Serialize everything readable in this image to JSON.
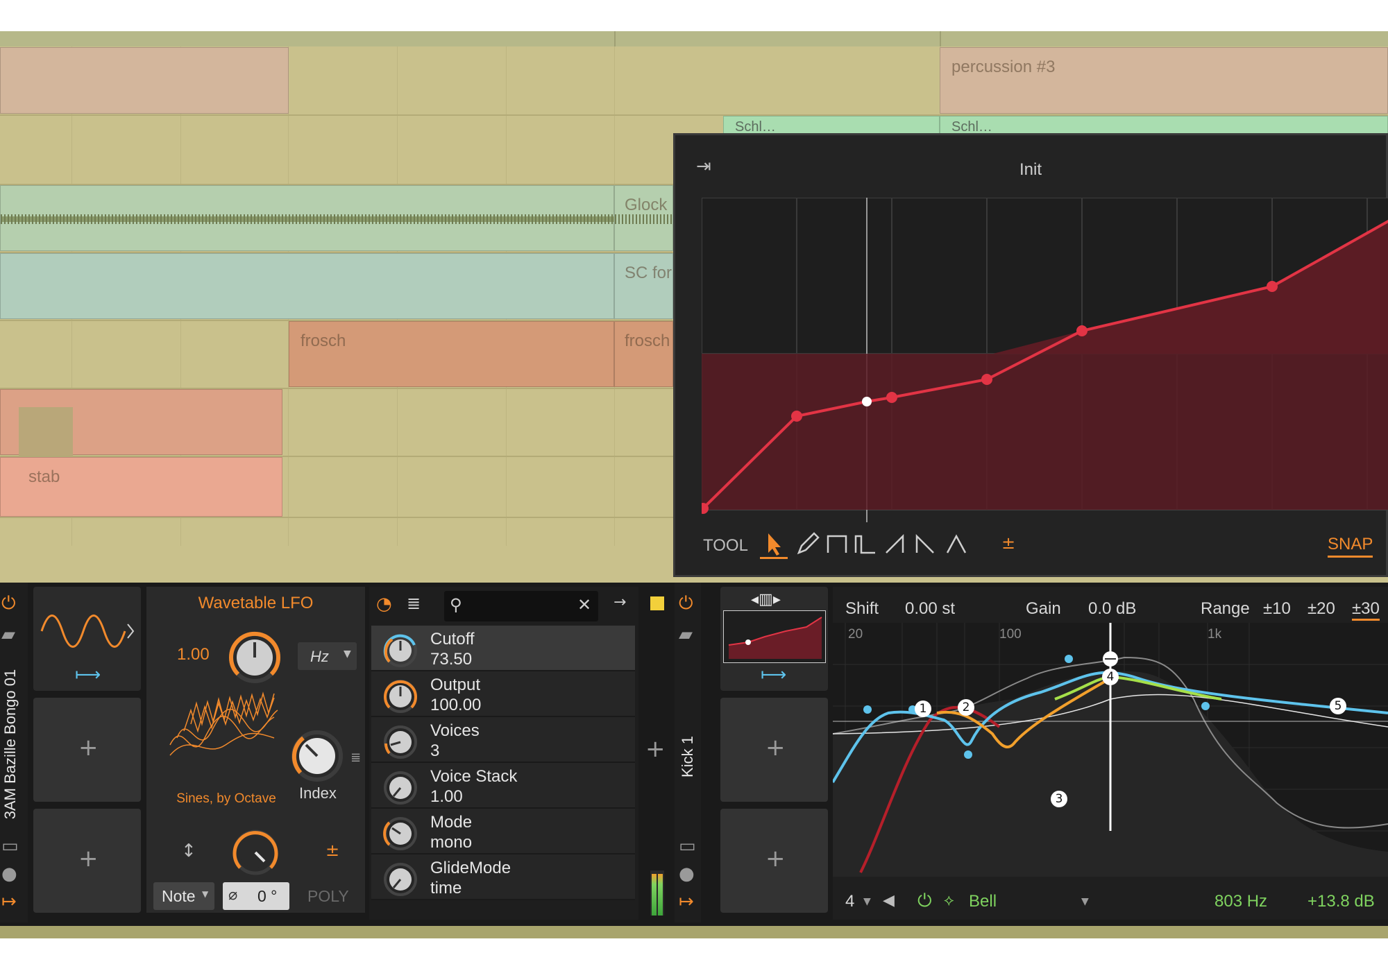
{
  "arranger": {
    "clips": {
      "percussion": "percussion #3",
      "sc_a": "Schl…",
      "sc_b": "Schl…",
      "glock": "Glock",
      "scfor": "SC for",
      "frosch1": "frosch",
      "frosch2": "frosch",
      "stab": "stab"
    }
  },
  "popup": {
    "title": "Init",
    "tool_label": "TOOL",
    "plus_minus": "±",
    "snap_label": "SNAP",
    "tools": [
      "pointer-icon",
      "pencil-icon",
      "square-wave-icon",
      "pulse-wave-icon",
      "saw-up-icon",
      "saw-down-icon",
      "triangle-icon"
    ]
  },
  "lfo": {
    "title": "Wavetable LFO",
    "rate_value": "1.00",
    "unit": "Hz",
    "wavetable_name": "Sines, by Octave",
    "index_label": "Index",
    "pm": "±",
    "mode": "Note",
    "phase_symbol": "⌀",
    "phase_value": "0 °",
    "poly": "POLY"
  },
  "params": [
    {
      "name": "Cutoff",
      "value": "73.50"
    },
    {
      "name": "Output",
      "value": "100.00"
    },
    {
      "name": "Voices",
      "value": "3"
    },
    {
      "name": "Voice Stack",
      "value": "1.00"
    },
    {
      "name": "Mode",
      "value": "mono"
    },
    {
      "name": "GlideMode",
      "value": "time"
    }
  ],
  "tracks": {
    "left": "3AM Bazille Bongo 01",
    "right": "Kick 1"
  },
  "eq": {
    "shift_label": "Shift",
    "shift_value": "0.00 st",
    "gain_label": "Gain",
    "gain_value": "0.0 dB",
    "range_label": "Range",
    "range_options": [
      "±10",
      "±20",
      "±30"
    ],
    "freq_ticks": [
      "20",
      "100",
      "1k"
    ],
    "band_number": "4",
    "band_type": "Bell",
    "band_freq": "803 Hz",
    "band_gain": "+13.8 dB",
    "nodes": [
      "1",
      "2",
      "3",
      "4",
      "5"
    ]
  },
  "colors": {
    "accent": "#f28a2c",
    "curve_red": "#e23445",
    "eq_blue": "#5ec3ec",
    "eq_green": "#7fd35f"
  }
}
